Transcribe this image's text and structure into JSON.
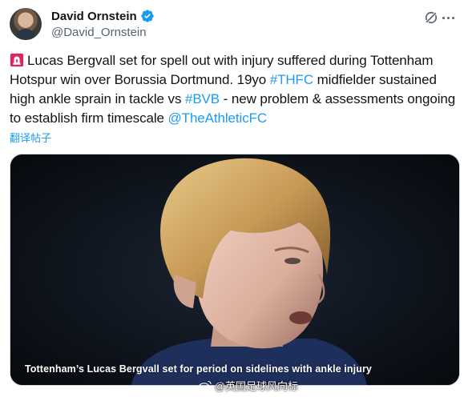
{
  "author": {
    "display_name": "David Ornstein",
    "handle": "@David_Ornstein",
    "verified": true
  },
  "tweet": {
    "part1": "Lucas Bergvall set for spell out with injury suffered during Tottenham Hotspur win over Borussia Dortmund. 19yo ",
    "hashtag_thfc": "#THFC",
    "part2": " midfielder sustained high ankle sprain in tackle vs ",
    "hashtag_bvb": "#BVB",
    "part3": " - new problem & assessments ongoing to establish firm timescale ",
    "mention": "@TheAthleticFC"
  },
  "translate_label": "翻译帖子",
  "media": {
    "caption": "Tottenham’s Lucas Bergvall set for period on sidelines with ankle injury"
  },
  "watermark": "@英国足球风向标",
  "colors": {
    "link": "#1d9bf0",
    "verified": "#1d9bf0",
    "text": "#0f1419",
    "secondary": "#536471"
  }
}
